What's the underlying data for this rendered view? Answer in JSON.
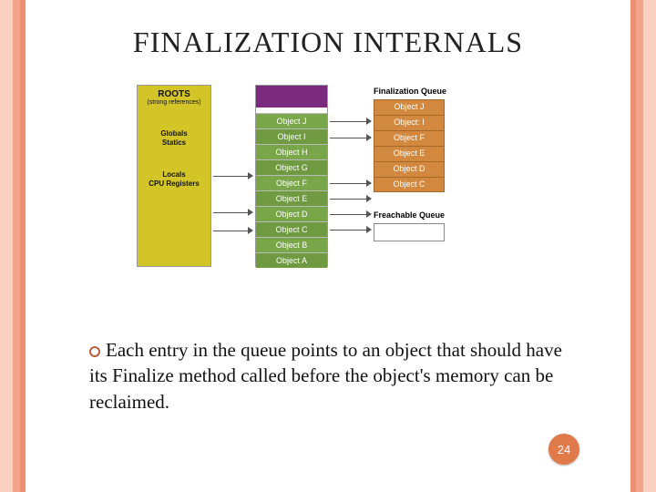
{
  "title": "FINALIZATION INTERNALS",
  "diagram": {
    "roots": {
      "title": "ROOTS",
      "sub": "(strong references)",
      "items": [
        "Globals",
        "Statics",
        "Locals",
        "CPU Registers"
      ]
    },
    "heap": {
      "objects": [
        "Object J",
        "Object I",
        "Object H",
        "Object G",
        "Object F",
        "Object E",
        "Object D",
        "Object C",
        "Object B",
        "Object A"
      ]
    },
    "finalization_queue": {
      "label": "Finalization Queue",
      "items": [
        "Object J",
        "Object: I",
        "Object F",
        "Object E",
        "Object D",
        "Object C"
      ]
    },
    "freachable_queue": {
      "label": "Freachable Queue"
    }
  },
  "bullet_text": "Each entry in the queue points to an object that should have its Finalize method called before the object's memory can be reclaimed.",
  "page_number": "24"
}
